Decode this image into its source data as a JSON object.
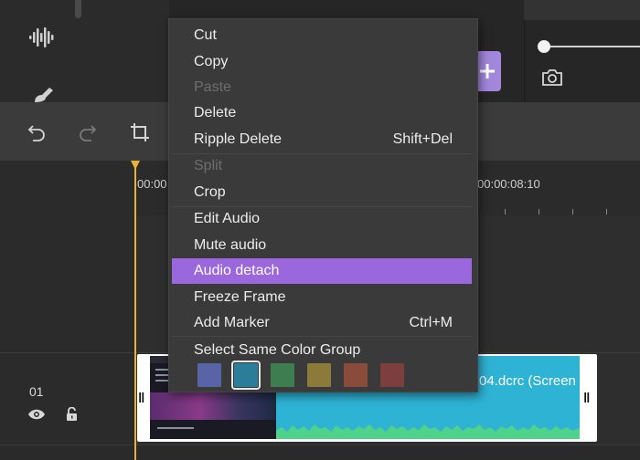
{
  "icons": {
    "waveform": "audio-waveform-icon",
    "brush": "brush-icon",
    "add": "plus-icon",
    "camera": "camera-icon",
    "undo": "undo-icon",
    "redo": "redo-icon",
    "crop": "crop-icon",
    "eye": "eye-icon",
    "lock": "unlock-icon"
  },
  "colors": {
    "accent": "#9b67dc",
    "add_button": "#a387dd",
    "playhead": "#e6b23a",
    "clip_audio": "#2fb3d4"
  },
  "preview": {
    "volume_level": 0
  },
  "ruler": {
    "start_label": "00:00",
    "mark_label": "00:00:08:10"
  },
  "track": {
    "number": "01",
    "clip_name": "04.dcrc (Screen"
  },
  "context_menu": {
    "items": [
      {
        "label": "Cut",
        "shortcut": "",
        "disabled": false,
        "active": false
      },
      {
        "label": "Copy",
        "shortcut": "",
        "disabled": false,
        "active": false
      },
      {
        "label": "Paste",
        "shortcut": "",
        "disabled": true,
        "active": false
      },
      {
        "label": "Delete",
        "shortcut": "",
        "disabled": false,
        "active": false
      },
      {
        "label": "Ripple Delete",
        "shortcut": "Shift+Del",
        "disabled": false,
        "active": false
      },
      {
        "label": "Split",
        "shortcut": "",
        "disabled": true,
        "active": false
      },
      {
        "label": "Crop",
        "shortcut": "",
        "disabled": false,
        "active": false
      },
      {
        "label": "Edit Audio",
        "shortcut": "",
        "disabled": false,
        "active": false
      },
      {
        "label": "Mute audio",
        "shortcut": "",
        "disabled": false,
        "active": false
      },
      {
        "label": "Audio detach",
        "shortcut": "",
        "disabled": false,
        "active": true
      },
      {
        "label": "Freeze Frame",
        "shortcut": "",
        "disabled": false,
        "active": false
      },
      {
        "label": "Add Marker",
        "shortcut": "Ctrl+M",
        "disabled": false,
        "active": false
      },
      {
        "label": "Select Same Color Group",
        "shortcut": "",
        "disabled": false,
        "active": false
      }
    ],
    "color_swatches": [
      {
        "name": "blue",
        "color": "#5964a6",
        "selected": false
      },
      {
        "name": "teal",
        "color": "#2b7d9a",
        "selected": true
      },
      {
        "name": "green",
        "color": "#3e7d50",
        "selected": false
      },
      {
        "name": "olive",
        "color": "#8c7a3a",
        "selected": false
      },
      {
        "name": "rust",
        "color": "#8a4c3a",
        "selected": false
      },
      {
        "name": "maroon",
        "color": "#7d3e3e",
        "selected": false
      }
    ]
  }
}
